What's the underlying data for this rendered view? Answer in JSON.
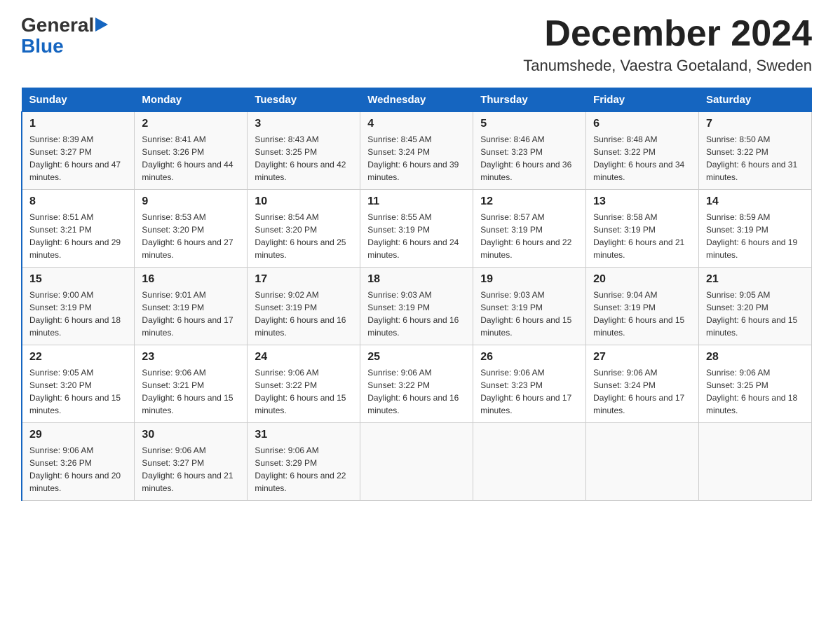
{
  "header": {
    "logo_general": "General",
    "logo_blue": "Blue",
    "month_year": "December 2024",
    "location": "Tanumshede, Vaestra Goetaland, Sweden"
  },
  "days_of_week": [
    "Sunday",
    "Monday",
    "Tuesday",
    "Wednesday",
    "Thursday",
    "Friday",
    "Saturday"
  ],
  "weeks": [
    [
      {
        "day": "1",
        "sunrise": "Sunrise: 8:39 AM",
        "sunset": "Sunset: 3:27 PM",
        "daylight": "Daylight: 6 hours and 47 minutes."
      },
      {
        "day": "2",
        "sunrise": "Sunrise: 8:41 AM",
        "sunset": "Sunset: 3:26 PM",
        "daylight": "Daylight: 6 hours and 44 minutes."
      },
      {
        "day": "3",
        "sunrise": "Sunrise: 8:43 AM",
        "sunset": "Sunset: 3:25 PM",
        "daylight": "Daylight: 6 hours and 42 minutes."
      },
      {
        "day": "4",
        "sunrise": "Sunrise: 8:45 AM",
        "sunset": "Sunset: 3:24 PM",
        "daylight": "Daylight: 6 hours and 39 minutes."
      },
      {
        "day": "5",
        "sunrise": "Sunrise: 8:46 AM",
        "sunset": "Sunset: 3:23 PM",
        "daylight": "Daylight: 6 hours and 36 minutes."
      },
      {
        "day": "6",
        "sunrise": "Sunrise: 8:48 AM",
        "sunset": "Sunset: 3:22 PM",
        "daylight": "Daylight: 6 hours and 34 minutes."
      },
      {
        "day": "7",
        "sunrise": "Sunrise: 8:50 AM",
        "sunset": "Sunset: 3:22 PM",
        "daylight": "Daylight: 6 hours and 31 minutes."
      }
    ],
    [
      {
        "day": "8",
        "sunrise": "Sunrise: 8:51 AM",
        "sunset": "Sunset: 3:21 PM",
        "daylight": "Daylight: 6 hours and 29 minutes."
      },
      {
        "day": "9",
        "sunrise": "Sunrise: 8:53 AM",
        "sunset": "Sunset: 3:20 PM",
        "daylight": "Daylight: 6 hours and 27 minutes."
      },
      {
        "day": "10",
        "sunrise": "Sunrise: 8:54 AM",
        "sunset": "Sunset: 3:20 PM",
        "daylight": "Daylight: 6 hours and 25 minutes."
      },
      {
        "day": "11",
        "sunrise": "Sunrise: 8:55 AM",
        "sunset": "Sunset: 3:19 PM",
        "daylight": "Daylight: 6 hours and 24 minutes."
      },
      {
        "day": "12",
        "sunrise": "Sunrise: 8:57 AM",
        "sunset": "Sunset: 3:19 PM",
        "daylight": "Daylight: 6 hours and 22 minutes."
      },
      {
        "day": "13",
        "sunrise": "Sunrise: 8:58 AM",
        "sunset": "Sunset: 3:19 PM",
        "daylight": "Daylight: 6 hours and 21 minutes."
      },
      {
        "day": "14",
        "sunrise": "Sunrise: 8:59 AM",
        "sunset": "Sunset: 3:19 PM",
        "daylight": "Daylight: 6 hours and 19 minutes."
      }
    ],
    [
      {
        "day": "15",
        "sunrise": "Sunrise: 9:00 AM",
        "sunset": "Sunset: 3:19 PM",
        "daylight": "Daylight: 6 hours and 18 minutes."
      },
      {
        "day": "16",
        "sunrise": "Sunrise: 9:01 AM",
        "sunset": "Sunset: 3:19 PM",
        "daylight": "Daylight: 6 hours and 17 minutes."
      },
      {
        "day": "17",
        "sunrise": "Sunrise: 9:02 AM",
        "sunset": "Sunset: 3:19 PM",
        "daylight": "Daylight: 6 hours and 16 minutes."
      },
      {
        "day": "18",
        "sunrise": "Sunrise: 9:03 AM",
        "sunset": "Sunset: 3:19 PM",
        "daylight": "Daylight: 6 hours and 16 minutes."
      },
      {
        "day": "19",
        "sunrise": "Sunrise: 9:03 AM",
        "sunset": "Sunset: 3:19 PM",
        "daylight": "Daylight: 6 hours and 15 minutes."
      },
      {
        "day": "20",
        "sunrise": "Sunrise: 9:04 AM",
        "sunset": "Sunset: 3:19 PM",
        "daylight": "Daylight: 6 hours and 15 minutes."
      },
      {
        "day": "21",
        "sunrise": "Sunrise: 9:05 AM",
        "sunset": "Sunset: 3:20 PM",
        "daylight": "Daylight: 6 hours and 15 minutes."
      }
    ],
    [
      {
        "day": "22",
        "sunrise": "Sunrise: 9:05 AM",
        "sunset": "Sunset: 3:20 PM",
        "daylight": "Daylight: 6 hours and 15 minutes."
      },
      {
        "day": "23",
        "sunrise": "Sunrise: 9:06 AM",
        "sunset": "Sunset: 3:21 PM",
        "daylight": "Daylight: 6 hours and 15 minutes."
      },
      {
        "day": "24",
        "sunrise": "Sunrise: 9:06 AM",
        "sunset": "Sunset: 3:22 PM",
        "daylight": "Daylight: 6 hours and 15 minutes."
      },
      {
        "day": "25",
        "sunrise": "Sunrise: 9:06 AM",
        "sunset": "Sunset: 3:22 PM",
        "daylight": "Daylight: 6 hours and 16 minutes."
      },
      {
        "day": "26",
        "sunrise": "Sunrise: 9:06 AM",
        "sunset": "Sunset: 3:23 PM",
        "daylight": "Daylight: 6 hours and 17 minutes."
      },
      {
        "day": "27",
        "sunrise": "Sunrise: 9:06 AM",
        "sunset": "Sunset: 3:24 PM",
        "daylight": "Daylight: 6 hours and 17 minutes."
      },
      {
        "day": "28",
        "sunrise": "Sunrise: 9:06 AM",
        "sunset": "Sunset: 3:25 PM",
        "daylight": "Daylight: 6 hours and 18 minutes."
      }
    ],
    [
      {
        "day": "29",
        "sunrise": "Sunrise: 9:06 AM",
        "sunset": "Sunset: 3:26 PM",
        "daylight": "Daylight: 6 hours and 20 minutes."
      },
      {
        "day": "30",
        "sunrise": "Sunrise: 9:06 AM",
        "sunset": "Sunset: 3:27 PM",
        "daylight": "Daylight: 6 hours and 21 minutes."
      },
      {
        "day": "31",
        "sunrise": "Sunrise: 9:06 AM",
        "sunset": "Sunset: 3:29 PM",
        "daylight": "Daylight: 6 hours and 22 minutes."
      },
      {
        "day": "",
        "sunrise": "",
        "sunset": "",
        "daylight": ""
      },
      {
        "day": "",
        "sunrise": "",
        "sunset": "",
        "daylight": ""
      },
      {
        "day": "",
        "sunrise": "",
        "sunset": "",
        "daylight": ""
      },
      {
        "day": "",
        "sunrise": "",
        "sunset": "",
        "daylight": ""
      }
    ]
  ]
}
